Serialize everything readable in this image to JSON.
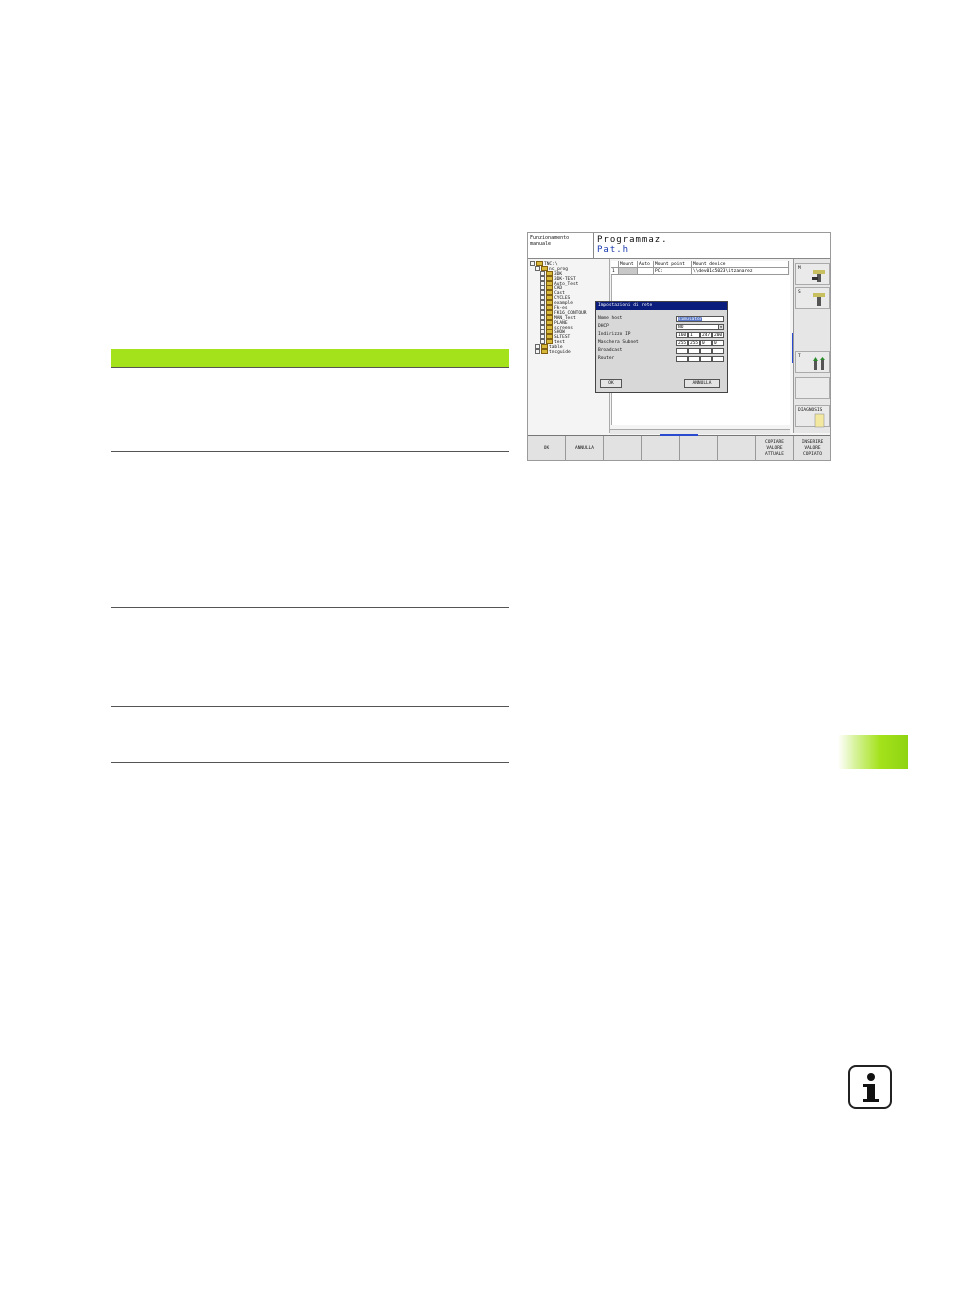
{
  "screen": {
    "header": {
      "mode_line1": "Funzionamento",
      "mode_line2": "manuale",
      "title": "Programmaz.",
      "program": "Pat.h"
    },
    "tree": [
      {
        "label": "TNC:\\",
        "level": 0
      },
      {
        "label": "nc_prog",
        "level": 1
      },
      {
        "label": "3DK",
        "level": 2
      },
      {
        "label": "3DK-TEST",
        "level": 2
      },
      {
        "label": "Auto_Test",
        "level": 2
      },
      {
        "label": "CAD",
        "level": 2
      },
      {
        "label": "Cast",
        "level": 2
      },
      {
        "label": "CYCLES",
        "level": 2
      },
      {
        "label": "example",
        "level": 2
      },
      {
        "label": "Fk-es",
        "level": 2
      },
      {
        "label": "FK16_CONTOUR",
        "level": 2
      },
      {
        "label": "MAN_Test",
        "level": 2
      },
      {
        "label": "PLANE",
        "level": 2
      },
      {
        "label": "screens",
        "level": 2
      },
      {
        "label": "SHOW",
        "level": 2
      },
      {
        "label": "SLTEST",
        "level": 2
      },
      {
        "label": "test",
        "level": 2
      },
      {
        "label": "table",
        "level": 1
      },
      {
        "label": "tncguide",
        "level": 1
      }
    ],
    "table": {
      "columns": [
        "",
        "Mount",
        "Auto",
        "Mount point",
        "Mount device"
      ],
      "rows": [
        [
          "1",
          "",
          "",
          "PC:",
          "\\\\dev01c5023\\itzanarez"
        ]
      ]
    },
    "dialog": {
      "title": "Impostazioni di rete",
      "host_label": "Nome host",
      "host_value": "simulator",
      "dhcp_label": "DHCP",
      "dhcp_value": "NO",
      "ip_label": "Indirizzo IP",
      "ip": [
        "160",
        "1",
        "247",
        "200"
      ],
      "mask_label": "Maschera Subnet",
      "mask": [
        "255",
        "255",
        "0",
        "0"
      ],
      "broadcast_label": "Broadcast",
      "router_label": "Router",
      "ok_label": "OK",
      "cancel_label": "ANNULLA"
    },
    "right_softkeys": {
      "m_label": "M",
      "s_label": "S",
      "t_label": "T",
      "diag_label": "DIAGNOSIS"
    },
    "bottom_softkeys": [
      "OK",
      "ANNULLA",
      "",
      "",
      "",
      "",
      "COPIARE VALORE ATTUALE",
      "INSERIRE VALORE COPIATO"
    ]
  },
  "colors": {
    "accent_green": "#a4e21b",
    "dialog_title": "#0a1c7c",
    "program_blue": "#1a3ab0"
  }
}
